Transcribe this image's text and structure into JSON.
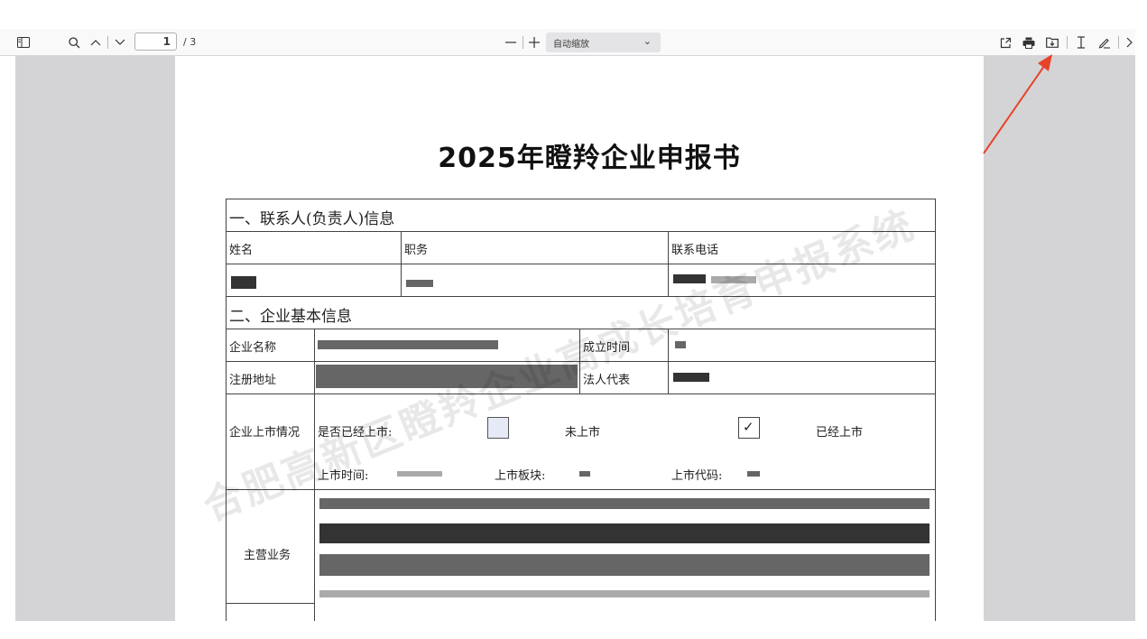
{
  "toolbar": {
    "page_current": "1",
    "page_total": "/ 3",
    "zoom_label": "自动缩放",
    "icons": [
      "sidebar-toggle-icon",
      "search-icon",
      "chevron-up-icon",
      "chevron-down-icon",
      "zoom-out-icon",
      "zoom-in-icon",
      "chevron-down-icon",
      "open-external-icon",
      "print-icon",
      "save-icon",
      "text-cursor-icon",
      "pencil-icon",
      "chevron-right-icon"
    ]
  },
  "document": {
    "title": "2025年瞪羚企业申报书",
    "watermark": "合肥高新区瞪羚企业高成长培育申报系统",
    "sections": {
      "contact": {
        "heading": "一、联系人(负责人)信息",
        "col_name": "姓名",
        "col_title": "职务",
        "col_phone": "联系电话"
      },
      "basic": {
        "heading": "二、企业基本信息",
        "company_name": "企业名称",
        "founded": "成立时间",
        "address": "注册地址",
        "legal_rep": "法人代表",
        "listing_status": "企业上市情况",
        "is_listed_q": "是否已经上市:",
        "not_listed": "未上市",
        "listed": "已经上市",
        "listing_time": "上市时间:",
        "listing_board": "上市板块:",
        "listing_code": "上市代码:",
        "main_business": "主营业务"
      }
    },
    "checkboxes": {
      "not_listed_checked": false,
      "listed_checked": true
    }
  },
  "annotation": {
    "arrow_color": "#e8432a"
  }
}
